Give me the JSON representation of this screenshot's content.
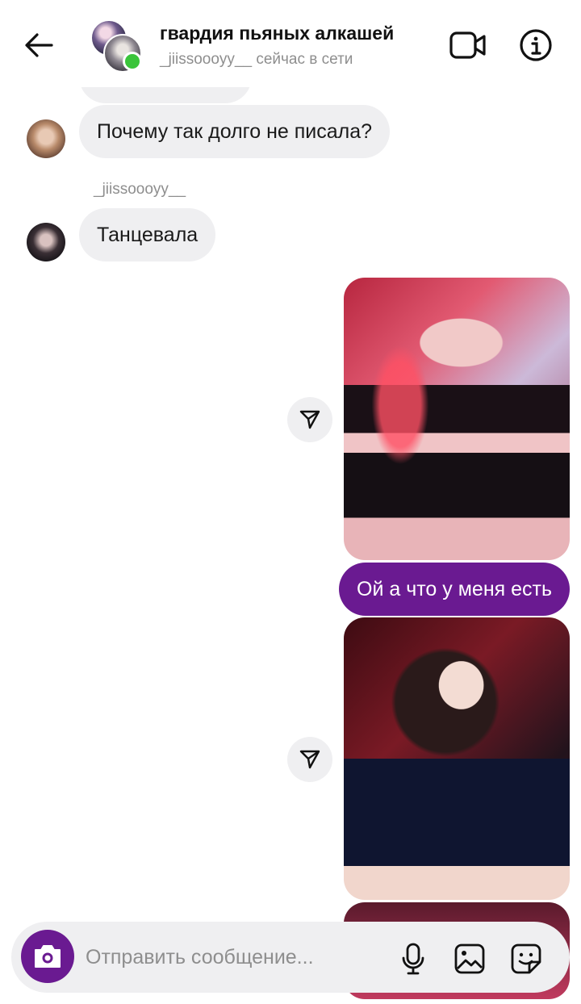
{
  "header": {
    "title": "гвардия пьяных алкашей",
    "subtitle": "_jiissoooyy__ сейчас в сети"
  },
  "messages": [
    {
      "sender_label": "",
      "text": "Почему так долго не писала?"
    },
    {
      "sender_label": "_jiissoooyy__",
      "text": "Танцевала"
    },
    {
      "own_text": "Ой а что у меня есть"
    }
  ],
  "composer": {
    "placeholder": "Отправить сообщение..."
  },
  "colors": {
    "accent": "#6a1a91",
    "incoming_bubble": "#efeff1",
    "online": "#3ac43a"
  },
  "icons": [
    "back-arrow-icon",
    "video-camera-icon",
    "info-icon",
    "send-icon",
    "camera-icon",
    "microphone-icon",
    "image-icon",
    "sticker-icon"
  ]
}
